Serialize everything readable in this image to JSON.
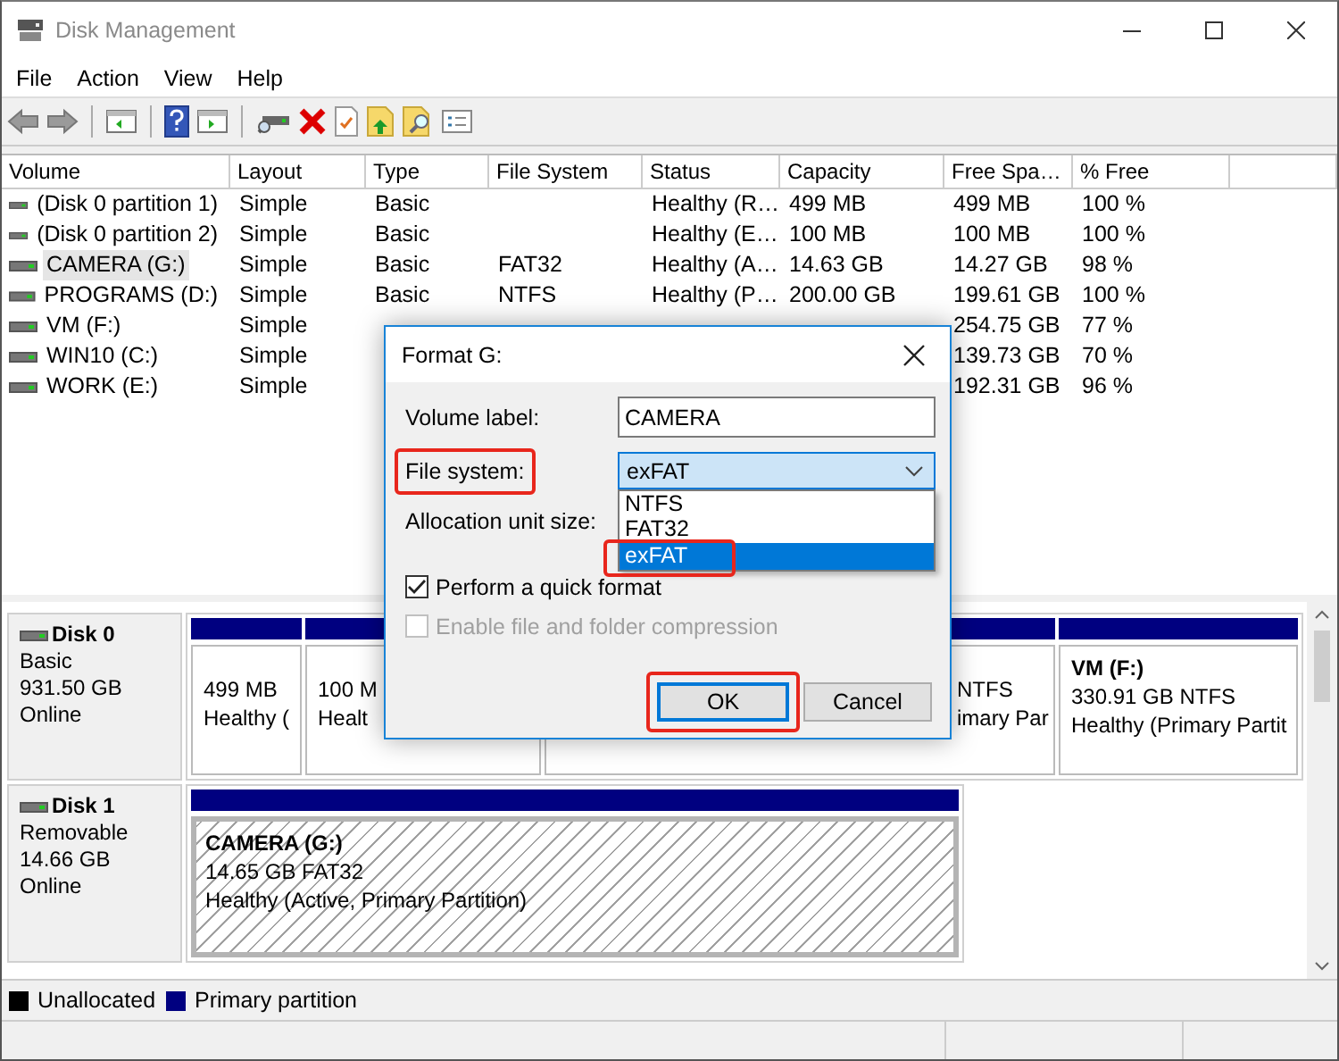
{
  "window": {
    "title": "Disk Management"
  },
  "menu": [
    "File",
    "Action",
    "View",
    "Help"
  ],
  "volumes": {
    "columns": [
      "Volume",
      "Layout",
      "Type",
      "File System",
      "Status",
      "Capacity",
      "Free Spa…",
      "% Free"
    ],
    "rows": [
      {
        "volume": "(Disk 0 partition 1)",
        "layout": "Simple",
        "type": "Basic",
        "status": "Healthy (R…",
        "capacity": "499 MB",
        "free_space": "499 MB",
        "percent_free": "100 %",
        "selected": false
      },
      {
        "volume": "(Disk 0 partition 2)",
        "layout": "Simple",
        "type": "Basic",
        "status": "Healthy (E…",
        "capacity": "100 MB",
        "free_space": "100 MB",
        "percent_free": "100 %",
        "selected": false
      },
      {
        "volume": "CAMERA (G:)",
        "layout": "Simple",
        "type": "Basic",
        "file_system": "FAT32",
        "status": "Healthy (A…",
        "capacity": "14.63 GB",
        "free_space": "14.27 GB",
        "percent_free": "98 %",
        "selected": true
      },
      {
        "volume": "PROGRAMS (D:)",
        "layout": "Simple",
        "type": "Basic",
        "file_system": "NTFS",
        "status": "Healthy (P…",
        "capacity": "200.00 GB",
        "free_space": "199.61 GB",
        "percent_free": "100 %",
        "selected": false
      },
      {
        "volume": "VM (F:)",
        "layout": "Simple",
        "free_space": "254.75 GB",
        "percent_free": "77 %",
        "selected": false
      },
      {
        "volume": "WIN10 (C:)",
        "layout": "Simple",
        "free_space": "139.73 GB",
        "percent_free": "70 %",
        "selected": false
      },
      {
        "volume": "WORK (E:)",
        "layout": "Simple",
        "free_space": "192.31 GB",
        "percent_free": "96 %",
        "selected": false
      }
    ]
  },
  "disks": [
    {
      "name": "Disk 0",
      "type": "Basic",
      "size": "931.50 GB",
      "status": "Online",
      "partitions": [
        {
          "size": "499 MB",
          "status": "Healthy (",
          "selected": false
        },
        {
          "size": "100 M",
          "status": "Healt",
          "selected": false
        },
        {
          "size": "NTFS",
          "status": "imary Par",
          "selected": false
        },
        {
          "name": "VM (F:)",
          "size": "330.91 GB NTFS",
          "status": "Healthy (Primary Partit",
          "selected": false
        }
      ]
    },
    {
      "name": "Disk 1",
      "type": "Removable",
      "size": "14.66 GB",
      "status": "Online",
      "partitions": [
        {
          "name": "CAMERA (G:)",
          "size": "14.65 GB FAT32",
          "status": "Healthy (Active, Primary Partition)",
          "selected": true
        }
      ]
    }
  ],
  "legend": [
    {
      "label": "Unallocated",
      "color": "#000000"
    },
    {
      "label": "Primary partition",
      "color": "#000080"
    }
  ],
  "format_dialog": {
    "title": "Format G:",
    "volume_label": {
      "label": "Volume label:",
      "value": "CAMERA"
    },
    "file_system": {
      "label": "File system:",
      "value": "exFAT",
      "highlighted": true,
      "expanded": true,
      "options": [
        {
          "label": "NTFS",
          "selected": false,
          "highlighted": false
        },
        {
          "label": "FAT32",
          "selected": false,
          "highlighted": false
        },
        {
          "label": "exFAT",
          "selected": true,
          "highlighted": true
        }
      ]
    },
    "allocation": {
      "label": "Allocation unit size:"
    },
    "checkboxes": [
      {
        "label": "Perform a quick format",
        "checked": true,
        "disabled": false
      },
      {
        "label": "Enable file and folder compression",
        "checked": false,
        "disabled": true
      }
    ],
    "buttons": [
      {
        "label": "OK",
        "default": true,
        "highlighted": true
      },
      {
        "label": "Cancel",
        "default": false,
        "highlighted": false
      }
    ]
  }
}
